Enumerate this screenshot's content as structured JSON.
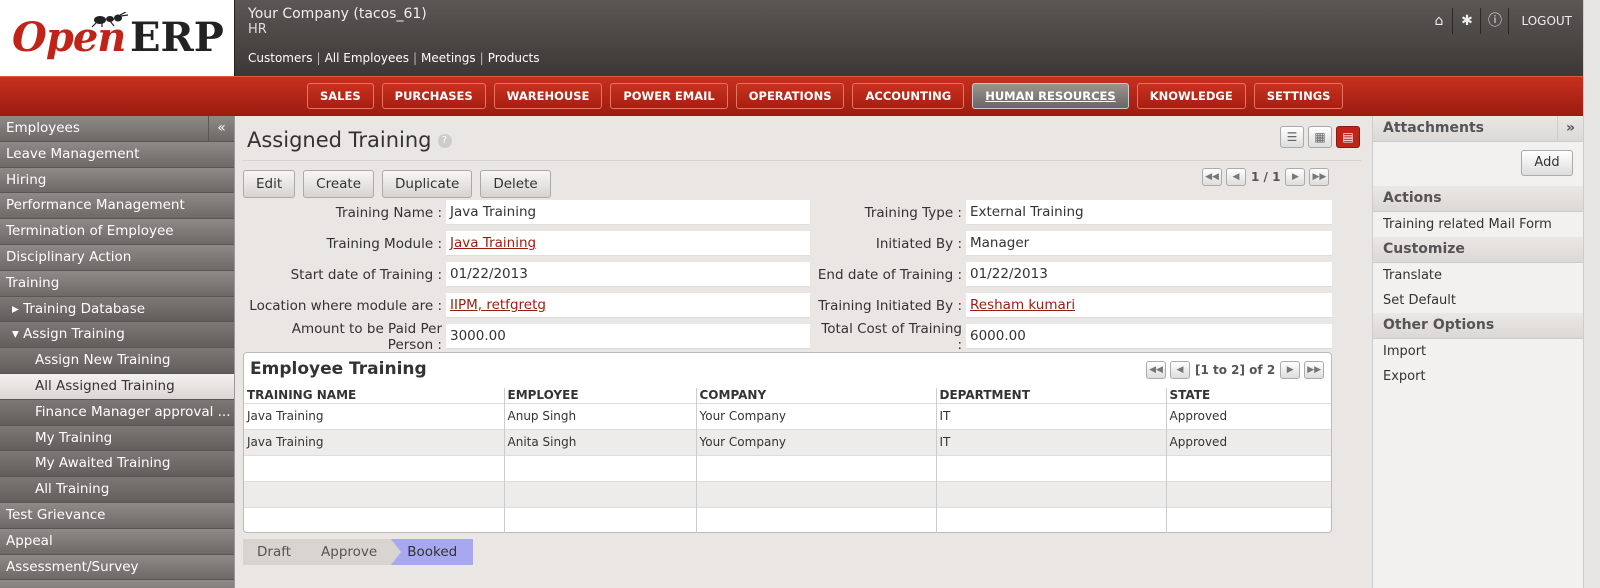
{
  "header": {
    "logo_open": "Open",
    "logo_erp": "ERP",
    "company": "Your Company (tacos_61)",
    "module": "HR",
    "shortcuts": [
      "Customers",
      "All Employees",
      "Meetings",
      "Products"
    ],
    "logout": "LOGOUT",
    "icons": [
      "home-icon",
      "gear-icon",
      "info-icon"
    ]
  },
  "menu": {
    "items": [
      "SALES",
      "PURCHASES",
      "WAREHOUSE",
      "POWER EMAIL",
      "OPERATIONS",
      "ACCOUNTING",
      "HUMAN RESOURCES",
      "KNOWLEDGE",
      "SETTINGS"
    ],
    "active": "HUMAN RESOURCES"
  },
  "sidebar": {
    "items": [
      {
        "label": "Employees",
        "level": 0
      },
      {
        "label": "Leave Management",
        "level": 0
      },
      {
        "label": "Hiring",
        "level": 0
      },
      {
        "label": "Performance Management",
        "level": 0
      },
      {
        "label": "Termination of Employee",
        "level": 0
      },
      {
        "label": "Disciplinary Action",
        "level": 0
      },
      {
        "label": "Training",
        "level": 0
      },
      {
        "label": "▸ Training Database",
        "level": 1
      },
      {
        "label": "▾ Assign Training",
        "level": 1
      },
      {
        "label": "Assign New Training",
        "level": 2
      },
      {
        "label": "All Assigned Training",
        "level": 2,
        "active": true
      },
      {
        "label": "Finance Manager approval ...",
        "level": 2
      },
      {
        "label": "My Training",
        "level": 2
      },
      {
        "label": "My Awaited Training",
        "level": 2
      },
      {
        "label": "All Training",
        "level": 2
      },
      {
        "label": "Test Grievance",
        "level": 0
      },
      {
        "label": "Appeal",
        "level": 0
      },
      {
        "label": "Assessment/Survey",
        "level": 0
      },
      {
        "label": "",
        "level": 0
      }
    ],
    "collapse_glyph": "«"
  },
  "page": {
    "title": "Assigned Training",
    "help_glyph": "?",
    "buttons": {
      "edit": "Edit",
      "create": "Create",
      "duplicate": "Duplicate",
      "delete": "Delete"
    },
    "pager": "1 / 1"
  },
  "form": {
    "left": [
      {
        "label": "Training Name :",
        "value": "Java Training",
        "link": false
      },
      {
        "label": "Training Module :",
        "value": "Java Training",
        "link": true
      },
      {
        "label": "Start date of Training :",
        "value": "01/22/2013",
        "link": false
      },
      {
        "label": "Location where module are :",
        "value": "IIPM, retfgretg",
        "link": true
      },
      {
        "label": "Amount to be Paid Per Person :",
        "value": "3000.00",
        "link": false
      }
    ],
    "right": [
      {
        "label": "Training Type :",
        "value": "External Training",
        "link": false
      },
      {
        "label": "Initiated By :",
        "value": "Manager",
        "link": false
      },
      {
        "label": "End date of Training :",
        "value": "01/22/2013",
        "link": false
      },
      {
        "label": "Training Initiated By :",
        "value": "Resham kumari",
        "link": true
      },
      {
        "label": "Total Cost of Training :",
        "value": "6000.00",
        "link": false
      }
    ]
  },
  "employee_training": {
    "title": "Employee Training",
    "pager": "[1 to 2] of 2",
    "columns": [
      "TRAINING NAME",
      "EMPLOYEE",
      "COMPANY",
      "DEPARTMENT",
      "STATE"
    ],
    "rows": [
      [
        "Java Training",
        "Anup Singh",
        "Your Company",
        "IT",
        "Approved"
      ],
      [
        "Java Training",
        "Anita Singh",
        "Your Company",
        "IT",
        "Approved"
      ],
      [
        "",
        "",
        "",
        "",
        ""
      ],
      [
        "",
        "",
        "",
        "",
        ""
      ],
      [
        "",
        "",
        "",
        "",
        ""
      ]
    ]
  },
  "status": {
    "steps": [
      "Draft",
      "Approve",
      "Booked"
    ],
    "active": "Booked"
  },
  "right_panel": {
    "attachments": "Attachments",
    "toggle": "»",
    "add": "Add",
    "actions_title": "Actions",
    "actions": [
      "Training related Mail Form"
    ],
    "customize_title": "Customize",
    "customize": [
      "Translate",
      "Set Default"
    ],
    "other_title": "Other Options",
    "other": [
      "Import",
      "Export"
    ]
  },
  "colors": {
    "brand_red": "#c02419",
    "active_status": "#a8a8f0"
  }
}
